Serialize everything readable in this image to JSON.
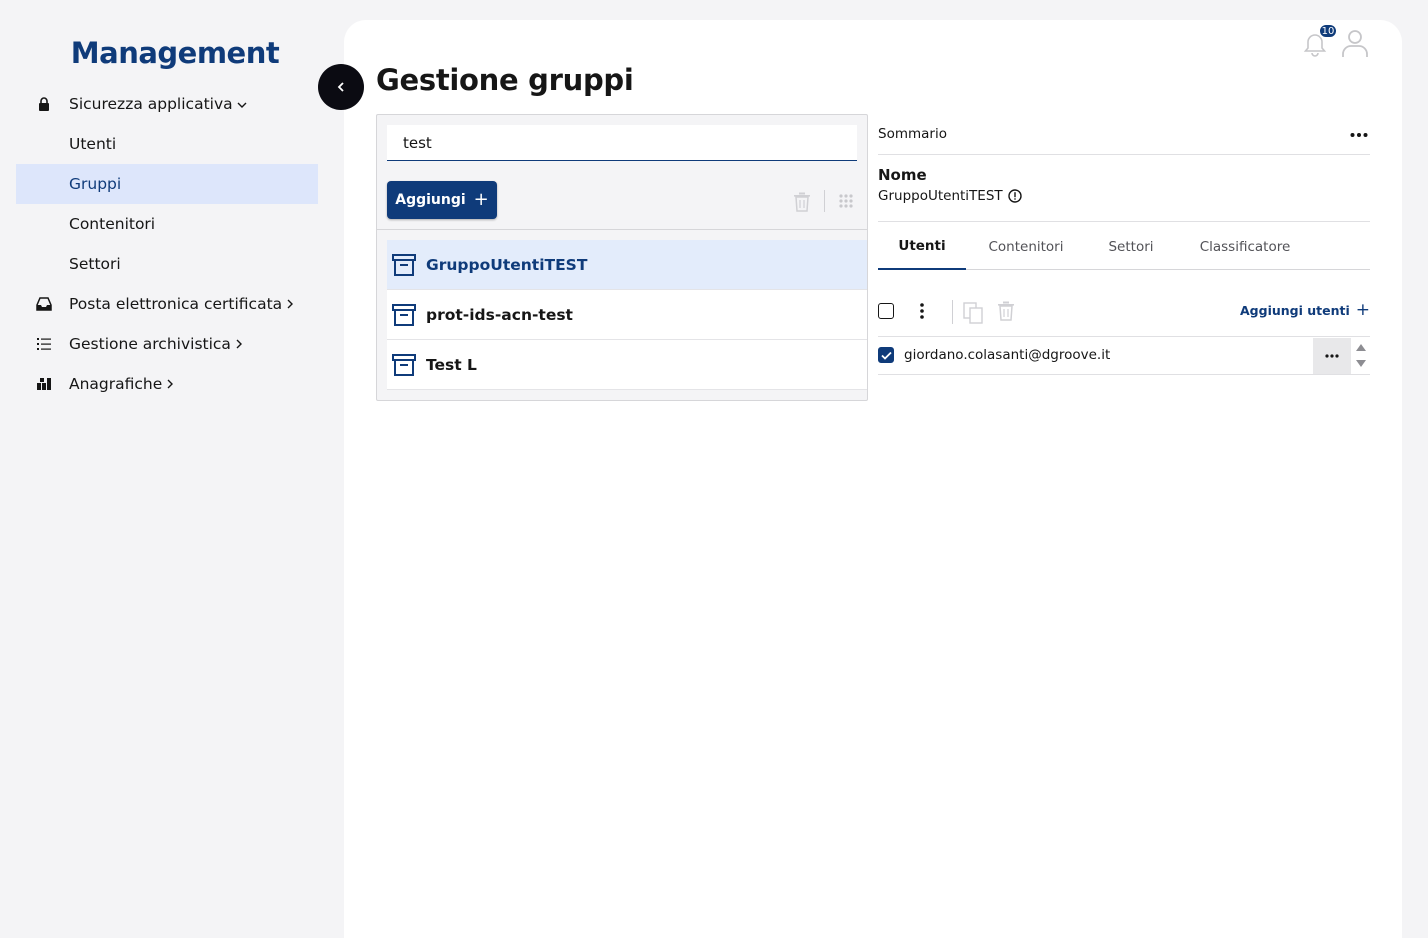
{
  "sidebar": {
    "brand": "Management",
    "items": [
      {
        "label": "Sicurezza applicativa",
        "icon": "lock-icon",
        "chevron": "⌄"
      },
      {
        "label": "Utenti"
      },
      {
        "label": "Gruppi"
      },
      {
        "label": "Contenitori"
      },
      {
        "label": "Settori"
      },
      {
        "label": "Posta elettronica certificata",
        "icon": "inbox-icon",
        "chevron": "›"
      },
      {
        "label": "Gestione archivistica",
        "icon": "list-icon",
        "chevron": "›"
      },
      {
        "label": "Anagrafiche",
        "icon": "dashboard-icon",
        "chevron": "›"
      }
    ],
    "collapse_glyph": "‹"
  },
  "header": {
    "title": "Gestione gruppi",
    "notification_count": "10"
  },
  "group_list": {
    "search_value": "test",
    "add_label": "Aggiungi",
    "items": [
      "GruppoUtentiTEST",
      "prot-ids-acn-test",
      "Test L"
    ]
  },
  "detail": {
    "summary_label": "Sommario",
    "name_label": "Nome",
    "name_value": "GruppoUtentiTEST",
    "tabs": [
      "Utenti",
      "Contenitori",
      "Settori",
      "Classificatore"
    ],
    "add_users_label": "Aggiungi utenti",
    "users": [
      {
        "email": "giordano.colasanti@dgroove.it",
        "checked": true
      }
    ]
  },
  "colors": {
    "accent": "#0f3b7a",
    "selected_bg": "#dde6fb",
    "page_bg": "#f4f4f6"
  }
}
